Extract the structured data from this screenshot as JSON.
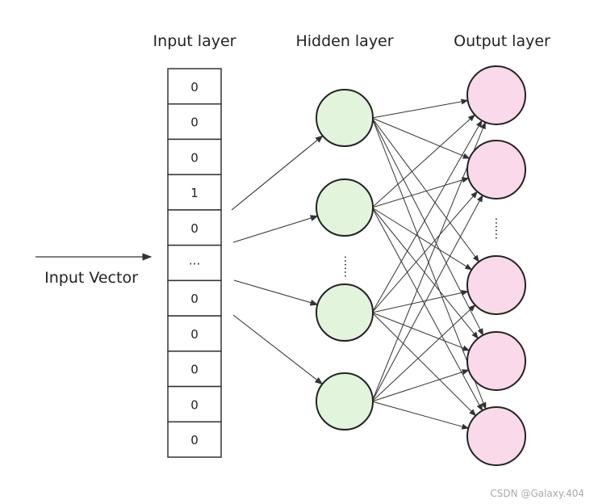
{
  "titles": {
    "input_layer": "Input layer",
    "hidden_layer": "Hidden layer",
    "output_layer": "Output layer"
  },
  "input_vector_label": "Input Vector",
  "input_cells": [
    "0",
    "0",
    "0",
    "1",
    "0",
    "...",
    "0",
    "0",
    "0",
    "0",
    "0"
  ],
  "hidden_ellipsis": "……",
  "output_ellipsis": "……",
  "watermark": "CSDN @Galaxy.404",
  "colors": {
    "hidden_fill": "#e2f4dc",
    "output_fill": "#f9d9ea",
    "stroke": "#222222",
    "edge": "#333333"
  }
}
